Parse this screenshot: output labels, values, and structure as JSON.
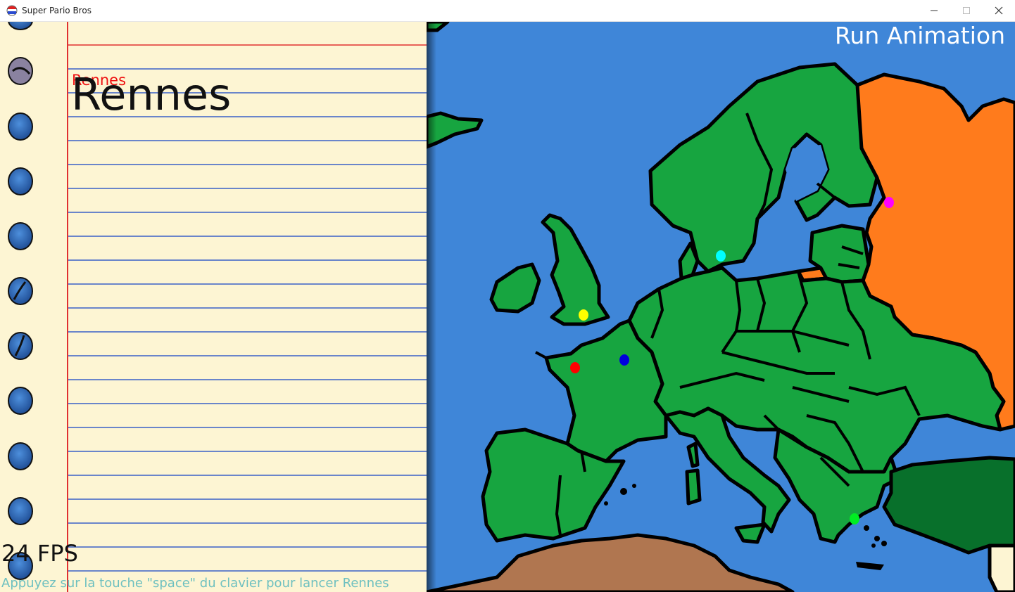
{
  "window": {
    "title": "Super Pario Bros",
    "icon": "app-icon"
  },
  "notebook": {
    "city_label_small": "Rennes",
    "city_label_large": "Rennes",
    "fps": "24 FPS",
    "hint": "Appuyez sur la touche \"space\" du clavier pour lancer Rennes"
  },
  "map": {
    "run_button_label": "Run Animation",
    "colors": {
      "sea": "#3f86d8",
      "land": "#17a540",
      "russia": "#ff7b1c",
      "turkey": "#08702b",
      "africa": "#b07650",
      "outline": "#000000"
    },
    "markers": [
      {
        "name": "yellow-marker",
        "color": "#ffff00"
      },
      {
        "name": "red-marker",
        "color": "#ff0000"
      },
      {
        "name": "blue-marker",
        "color": "#0000dd"
      },
      {
        "name": "cyan-marker",
        "color": "#00ffff"
      },
      {
        "name": "magenta-marker",
        "color": "#ff00ff"
      },
      {
        "name": "green-marker",
        "color": "#00ee22"
      }
    ]
  }
}
